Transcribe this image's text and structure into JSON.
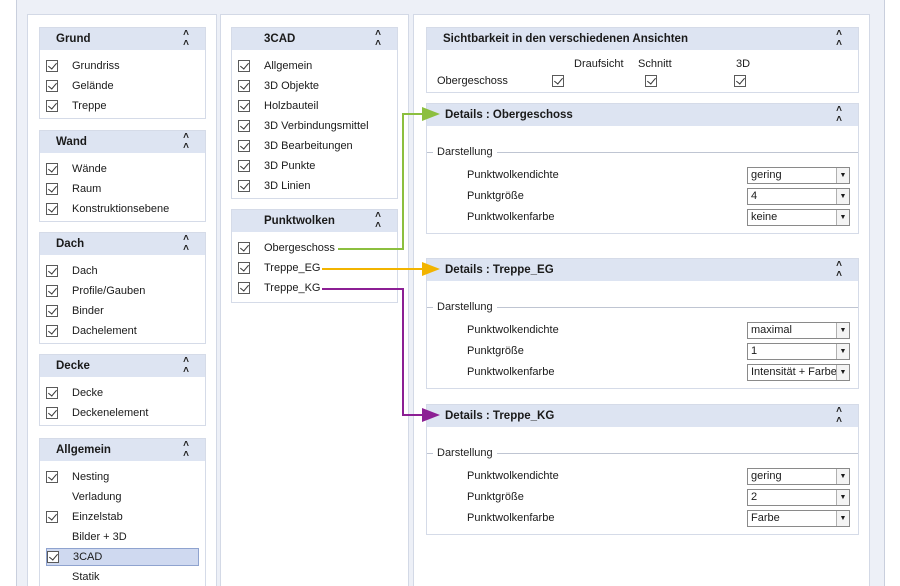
{
  "left_sections": [
    {
      "title": "Grund",
      "items": [
        {
          "label": "Grundriss",
          "checked": true
        },
        {
          "label": "Gelände",
          "checked": true
        },
        {
          "label": "Treppe",
          "checked": true
        }
      ]
    },
    {
      "title": "Wand",
      "items": [
        {
          "label": "Wände",
          "checked": true
        },
        {
          "label": "Raum",
          "checked": true
        },
        {
          "label": "Konstruktionsebene",
          "checked": true
        }
      ]
    },
    {
      "title": "Dach",
      "items": [
        {
          "label": "Dach",
          "checked": true
        },
        {
          "label": "Profile/Gauben",
          "checked": true
        },
        {
          "label": "Binder",
          "checked": true
        },
        {
          "label": "Dachelement",
          "checked": true
        }
      ]
    },
    {
      "title": "Decke",
      "items": [
        {
          "label": "Decke",
          "checked": true
        },
        {
          "label": "Deckenelement",
          "checked": true
        }
      ]
    },
    {
      "title": "Allgemein",
      "items": [
        {
          "label": "Nesting",
          "checked": true
        },
        {
          "label": "Verladung",
          "checked": false
        },
        {
          "label": "Einzelstab",
          "checked": true
        },
        {
          "label": "Bilder + 3D",
          "checked": false
        },
        {
          "label": "3CAD",
          "checked": true,
          "selected": true
        },
        {
          "label": "Statik",
          "checked": false
        }
      ]
    }
  ],
  "cad_panel": {
    "title": "3CAD",
    "items": [
      {
        "label": "Allgemein",
        "checked": true
      },
      {
        "label": "3D Objekte",
        "checked": true
      },
      {
        "label": "Holzbauteil",
        "checked": true
      },
      {
        "label": "3D Verbindungsmittel",
        "checked": true
      },
      {
        "label": "3D Bearbeitungen",
        "checked": true
      },
      {
        "label": "3D Punkte",
        "checked": true
      },
      {
        "label": "3D Linien",
        "checked": true
      }
    ]
  },
  "pw_panel": {
    "title": "Punktwolken",
    "items": [
      {
        "label": "Obergeschoss",
        "checked": true
      },
      {
        "label": "Treppe_EG",
        "checked": true
      },
      {
        "label": "Treppe_KG",
        "checked": true
      }
    ]
  },
  "visibility": {
    "title": "Sichtbarkeit in den verschiedenen Ansichten",
    "columns": [
      "Draufsicht",
      "Schnitt",
      "3D"
    ],
    "row_label": "Obergeschoss",
    "values": [
      true,
      true,
      true
    ]
  },
  "details": [
    {
      "title": "Details : Obergeschoss",
      "group": "Darstellung",
      "props": [
        {
          "label": "Punktwolkendichte",
          "value": "gering"
        },
        {
          "label": "Punktgröße",
          "value": "4"
        },
        {
          "label": "Punktwolkenfarbe",
          "value": "keine"
        }
      ]
    },
    {
      "title": "Details : Treppe_EG",
      "group": "Darstellung",
      "props": [
        {
          "label": "Punktwolkendichte",
          "value": "maximal"
        },
        {
          "label": "Punktgröße",
          "value": "1"
        },
        {
          "label": "Punktwolkenfarbe",
          "value": "Intensität + Farbe"
        }
      ]
    },
    {
      "title": "Details : Treppe_KG",
      "group": "Darstellung",
      "props": [
        {
          "label": "Punktwolkendichte",
          "value": "gering"
        },
        {
          "label": "Punktgröße",
          "value": "2"
        },
        {
          "label": "Punktwolkenfarbe",
          "value": "Farbe"
        }
      ]
    }
  ],
  "icons": {
    "collapse": "double-chevron-up-icon",
    "dropdown": "dropdown-arrow-icon",
    "check": "checkbox-check-icon"
  },
  "arrow_colors": {
    "obergeschoss": "#8cbf3f",
    "treppe_eg": "#f2b400",
    "treppe_kg": "#8c1f94"
  }
}
